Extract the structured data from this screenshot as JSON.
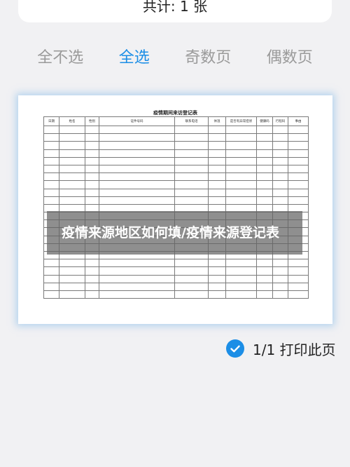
{
  "header": {
    "total_label": "共计: 1 张"
  },
  "tabs": [
    {
      "label": "全不选",
      "active": false
    },
    {
      "label": "全选",
      "active": true
    },
    {
      "label": "奇数页",
      "active": false
    },
    {
      "label": "偶数页",
      "active": false
    }
  ],
  "preview": {
    "sheet_title": "疫情期间来访登记表",
    "columns": [
      "日期",
      "姓名",
      "性别",
      "证件号码",
      "联系电话",
      "体温",
      "是否有异常症状",
      "健康码",
      "行程码",
      "事由"
    ],
    "empty_row_count": 22
  },
  "overlay": {
    "text": "疫情来源地区如何填/疫情来源登记表"
  },
  "page_selector": {
    "label": "1/1 打印此页",
    "checked": true
  },
  "colors": {
    "accent": "#1c8ee6",
    "background": "#f1f1f3",
    "inactive_tab": "#9a9a9a"
  }
}
